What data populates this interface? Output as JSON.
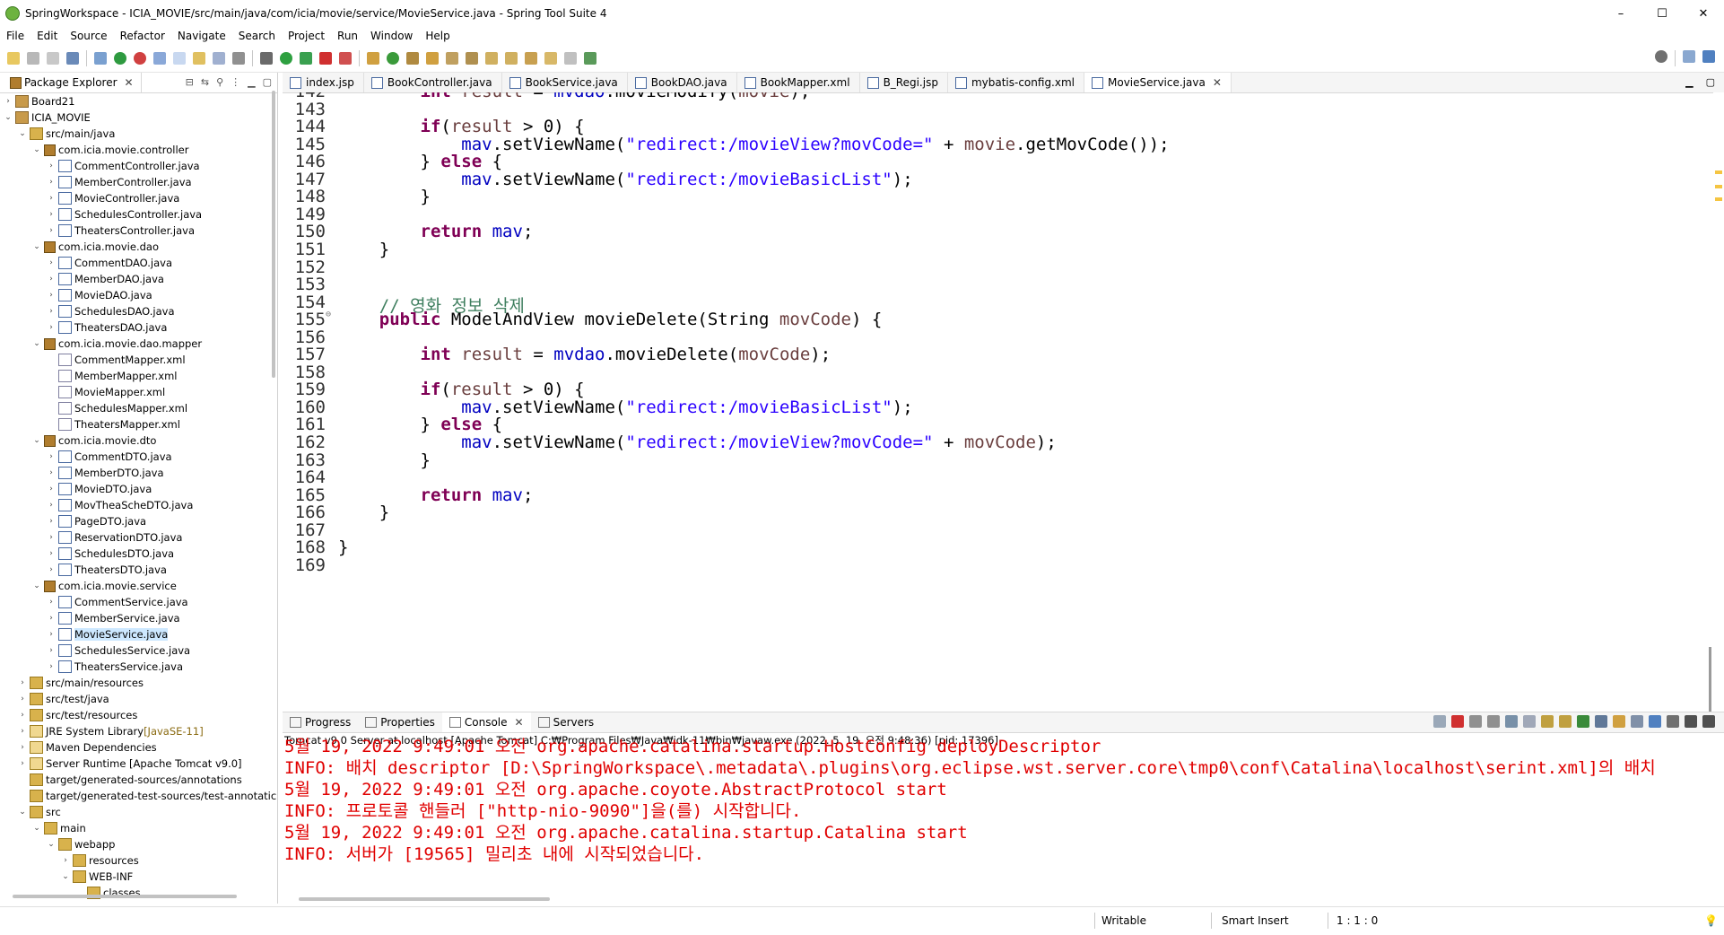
{
  "window": {
    "title": "SpringWorkspace - ICIA_MOVIE/src/main/java/com/icia/movie/service/MovieService.java - Spring Tool Suite 4",
    "minimize": "–",
    "maximize": "☐",
    "close": "✕"
  },
  "menu": [
    "File",
    "Edit",
    "Source",
    "Refactor",
    "Navigate",
    "Search",
    "Project",
    "Run",
    "Window",
    "Help"
  ],
  "package_explorer": {
    "tab_label": "Package Explorer",
    "tree": [
      {
        "label": "Board21",
        "level": 0,
        "twisty": "›",
        "icon": "proj"
      },
      {
        "label": "ICIA_MOVIE",
        "level": 0,
        "twisty": "⌄",
        "icon": "proj"
      },
      {
        "label": "src/main/java",
        "level": 1,
        "twisty": "⌄",
        "icon": "folder"
      },
      {
        "label": "com.icia.movie.controller",
        "level": 2,
        "twisty": "⌄",
        "icon": "pkg"
      },
      {
        "label": "CommentController.java",
        "level": 3,
        "twisty": "›",
        "icon": "java"
      },
      {
        "label": "MemberController.java",
        "level": 3,
        "twisty": "›",
        "icon": "java"
      },
      {
        "label": "MovieController.java",
        "level": 3,
        "twisty": "›",
        "icon": "java"
      },
      {
        "label": "SchedulesController.java",
        "level": 3,
        "twisty": "›",
        "icon": "java"
      },
      {
        "label": "TheatersController.java",
        "level": 3,
        "twisty": "›",
        "icon": "java"
      },
      {
        "label": "com.icia.movie.dao",
        "level": 2,
        "twisty": "⌄",
        "icon": "pkg"
      },
      {
        "label": "CommentDAO.java",
        "level": 3,
        "twisty": "›",
        "icon": "java"
      },
      {
        "label": "MemberDAO.java",
        "level": 3,
        "twisty": "›",
        "icon": "java"
      },
      {
        "label": "MovieDAO.java",
        "level": 3,
        "twisty": "›",
        "icon": "java"
      },
      {
        "label": "SchedulesDAO.java",
        "level": 3,
        "twisty": "›",
        "icon": "java"
      },
      {
        "label": "TheatersDAO.java",
        "level": 3,
        "twisty": "›",
        "icon": "java"
      },
      {
        "label": "com.icia.movie.dao.mapper",
        "level": 2,
        "twisty": "⌄",
        "icon": "pkg"
      },
      {
        "label": "CommentMapper.xml",
        "level": 3,
        "twisty": "",
        "icon": "xml"
      },
      {
        "label": "MemberMapper.xml",
        "level": 3,
        "twisty": "",
        "icon": "xml"
      },
      {
        "label": "MovieMapper.xml",
        "level": 3,
        "twisty": "",
        "icon": "xml"
      },
      {
        "label": "SchedulesMapper.xml",
        "level": 3,
        "twisty": "",
        "icon": "xml"
      },
      {
        "label": "TheatersMapper.xml",
        "level": 3,
        "twisty": "",
        "icon": "xml"
      },
      {
        "label": "com.icia.movie.dto",
        "level": 2,
        "twisty": "⌄",
        "icon": "pkg"
      },
      {
        "label": "CommentDTO.java",
        "level": 3,
        "twisty": "›",
        "icon": "java"
      },
      {
        "label": "MemberDTO.java",
        "level": 3,
        "twisty": "›",
        "icon": "java"
      },
      {
        "label": "MovieDTO.java",
        "level": 3,
        "twisty": "›",
        "icon": "java"
      },
      {
        "label": "MovTheaScheDTO.java",
        "level": 3,
        "twisty": "›",
        "icon": "java"
      },
      {
        "label": "PageDTO.java",
        "level": 3,
        "twisty": "›",
        "icon": "java"
      },
      {
        "label": "ReservationDTO.java",
        "level": 3,
        "twisty": "›",
        "icon": "java"
      },
      {
        "label": "SchedulesDTO.java",
        "level": 3,
        "twisty": "›",
        "icon": "java"
      },
      {
        "label": "TheatersDTO.java",
        "level": 3,
        "twisty": "›",
        "icon": "java"
      },
      {
        "label": "com.icia.movie.service",
        "level": 2,
        "twisty": "⌄",
        "icon": "pkg"
      },
      {
        "label": "CommentService.java",
        "level": 3,
        "twisty": "›",
        "icon": "java"
      },
      {
        "label": "MemberService.java",
        "level": 3,
        "twisty": "›",
        "icon": "java"
      },
      {
        "label": "MovieService.java",
        "level": 3,
        "twisty": "›",
        "icon": "java",
        "selected": true
      },
      {
        "label": "SchedulesService.java",
        "level": 3,
        "twisty": "›",
        "icon": "java"
      },
      {
        "label": "TheatersService.java",
        "level": 3,
        "twisty": "›",
        "icon": "java"
      },
      {
        "label": "src/main/resources",
        "level": 1,
        "twisty": "›",
        "icon": "folder"
      },
      {
        "label": "src/test/java",
        "level": 1,
        "twisty": "›",
        "icon": "folder"
      },
      {
        "label": "src/test/resources",
        "level": 1,
        "twisty": "›",
        "icon": "folder"
      },
      {
        "label": "JRE System Library",
        "suffix": " [JavaSE-11]",
        "level": 1,
        "twisty": "›",
        "icon": "lib"
      },
      {
        "label": "Maven Dependencies",
        "level": 1,
        "twisty": "›",
        "icon": "lib"
      },
      {
        "label": "Server Runtime [Apache Tomcat v9.0]",
        "level": 1,
        "twisty": "›",
        "icon": "lib"
      },
      {
        "label": "target/generated-sources/annotations",
        "level": 1,
        "twisty": "",
        "icon": "folder"
      },
      {
        "label": "target/generated-test-sources/test-annotatic",
        "level": 1,
        "twisty": "",
        "icon": "folder"
      },
      {
        "label": "src",
        "level": 1,
        "twisty": "⌄",
        "icon": "folder"
      },
      {
        "label": "main",
        "level": 2,
        "twisty": "⌄",
        "icon": "folder"
      },
      {
        "label": "webapp",
        "level": 3,
        "twisty": "⌄",
        "icon": "folder"
      },
      {
        "label": "resources",
        "level": 4,
        "twisty": "›",
        "icon": "folder"
      },
      {
        "label": "WEB-INF",
        "level": 4,
        "twisty": "⌄",
        "icon": "folder"
      },
      {
        "label": "classes",
        "level": 5,
        "twisty": "",
        "icon": "folder"
      }
    ]
  },
  "editor": {
    "tabs": [
      {
        "label": "index.jsp",
        "active": false
      },
      {
        "label": "BookController.java",
        "active": false
      },
      {
        "label": "BookService.java",
        "active": false
      },
      {
        "label": "BookDAO.java",
        "active": false
      },
      {
        "label": "BookMapper.xml",
        "active": false
      },
      {
        "label": "B_Regi.jsp",
        "active": false
      },
      {
        "label": "mybatis-config.xml",
        "active": false
      },
      {
        "label": "MovieService.java",
        "active": true
      }
    ],
    "lines": [
      {
        "n": "142",
        "fold": "",
        "tokens": [
          [
            "",
            "        "
          ],
          [
            "kw",
            "int"
          ],
          [
            "",
            " "
          ],
          [
            "lv",
            "result"
          ],
          [
            "",
            " = "
          ],
          [
            "fld",
            "mvdao"
          ],
          [
            "",
            ".movieModify("
          ],
          [
            "lv",
            "movie"
          ],
          [
            "",
            ");"
          ]
        ]
      },
      {
        "n": "143",
        "fold": "",
        "tokens": []
      },
      {
        "n": "144",
        "fold": "",
        "tokens": [
          [
            "",
            "        "
          ],
          [
            "kw",
            "if"
          ],
          [
            "",
            "("
          ],
          [
            "lv",
            "result"
          ],
          [
            "",
            " > 0) {"
          ]
        ]
      },
      {
        "n": "145",
        "fold": "",
        "tokens": [
          [
            "",
            "            "
          ],
          [
            "fld",
            "mav"
          ],
          [
            "",
            ".setViewName("
          ],
          [
            "str",
            "\"redirect:/movieView?movCode=\""
          ],
          [
            "",
            " + "
          ],
          [
            "lv",
            "movie"
          ],
          [
            "",
            ".getMovCode());"
          ]
        ]
      },
      {
        "n": "146",
        "fold": "",
        "tokens": [
          [
            "",
            "        } "
          ],
          [
            "kw",
            "else"
          ],
          [
            "",
            " {"
          ]
        ]
      },
      {
        "n": "147",
        "fold": "",
        "tokens": [
          [
            "",
            "            "
          ],
          [
            "fld",
            "mav"
          ],
          [
            "",
            ".setViewName("
          ],
          [
            "str",
            "\"redirect:/movieBasicList\""
          ],
          [
            "",
            ");"
          ]
        ]
      },
      {
        "n": "148",
        "fold": "",
        "tokens": [
          [
            "",
            "        }"
          ]
        ]
      },
      {
        "n": "149",
        "fold": "",
        "tokens": []
      },
      {
        "n": "150",
        "fold": "",
        "tokens": [
          [
            "",
            "        "
          ],
          [
            "kw",
            "return"
          ],
          [
            "",
            " "
          ],
          [
            "fld",
            "mav"
          ],
          [
            "",
            ";"
          ]
        ]
      },
      {
        "n": "151",
        "fold": "",
        "tokens": [
          [
            "",
            "    }"
          ]
        ]
      },
      {
        "n": "152",
        "fold": "",
        "tokens": []
      },
      {
        "n": "153",
        "fold": "",
        "tokens": []
      },
      {
        "n": "154",
        "fold": "",
        "tokens": [
          [
            "",
            "    "
          ],
          [
            "cm",
            "// 영화 정보 삭제"
          ]
        ]
      },
      {
        "n": "155",
        "fold": "⊖",
        "tokens": [
          [
            "",
            "    "
          ],
          [
            "kw",
            "public"
          ],
          [
            "",
            " ModelAndView movieDelete(String "
          ],
          [
            "lv",
            "movCode"
          ],
          [
            "",
            ") {"
          ]
        ]
      },
      {
        "n": "156",
        "fold": "",
        "tokens": []
      },
      {
        "n": "157",
        "fold": "",
        "tokens": [
          [
            "",
            "        "
          ],
          [
            "kw",
            "int"
          ],
          [
            "",
            " "
          ],
          [
            "lv",
            "result"
          ],
          [
            "",
            " = "
          ],
          [
            "fld",
            "mvdao"
          ],
          [
            "",
            ".movieDelete("
          ],
          [
            "lv",
            "movCode"
          ],
          [
            "",
            ");"
          ]
        ]
      },
      {
        "n": "158",
        "fold": "",
        "tokens": []
      },
      {
        "n": "159",
        "fold": "",
        "tokens": [
          [
            "",
            "        "
          ],
          [
            "kw",
            "if"
          ],
          [
            "",
            "("
          ],
          [
            "lv",
            "result"
          ],
          [
            "",
            " > 0) {"
          ]
        ]
      },
      {
        "n": "160",
        "fold": "",
        "tokens": [
          [
            "",
            "            "
          ],
          [
            "fld",
            "mav"
          ],
          [
            "",
            ".setViewName("
          ],
          [
            "str",
            "\"redirect:/movieBasicList\""
          ],
          [
            "",
            ");"
          ]
        ]
      },
      {
        "n": "161",
        "fold": "",
        "tokens": [
          [
            "",
            "        } "
          ],
          [
            "kw",
            "else"
          ],
          [
            "",
            " {"
          ]
        ]
      },
      {
        "n": "162",
        "fold": "",
        "tokens": [
          [
            "",
            "            "
          ],
          [
            "fld",
            "mav"
          ],
          [
            "",
            ".setViewName("
          ],
          [
            "str",
            "\"redirect:/movieView?movCode=\""
          ],
          [
            "",
            " + "
          ],
          [
            "lv",
            "movCode"
          ],
          [
            "",
            ");"
          ]
        ]
      },
      {
        "n": "163",
        "fold": "",
        "tokens": [
          [
            "",
            "        }"
          ]
        ]
      },
      {
        "n": "164",
        "fold": "",
        "tokens": []
      },
      {
        "n": "165",
        "fold": "",
        "tokens": [
          [
            "",
            "        "
          ],
          [
            "kw",
            "return"
          ],
          [
            "",
            " "
          ],
          [
            "fld",
            "mav"
          ],
          [
            "",
            ";"
          ]
        ]
      },
      {
        "n": "166",
        "fold": "",
        "tokens": [
          [
            "",
            "    }"
          ]
        ]
      },
      {
        "n": "167",
        "fold": "",
        "tokens": []
      },
      {
        "n": "168",
        "fold": "",
        "tokens": [
          [
            "",
            "}"
          ]
        ]
      },
      {
        "n": "169",
        "fold": "",
        "tokens": []
      }
    ]
  },
  "console_view": {
    "tabs": [
      {
        "label": "Progress",
        "active": false
      },
      {
        "label": "Properties",
        "active": false
      },
      {
        "label": "Console",
        "active": true
      },
      {
        "label": "Servers",
        "active": false
      }
    ],
    "description": "Tomcat v9.0 Server at localhost [Apache Tomcat] C:₩Program Files₩Java₩jdk-11₩bin₩javaw.exe  (2022. 5. 19. 오전 9:48:36) [pid: 17396]",
    "output": [
      "5월 19, 2022 9:49:01 오전 org.apache.catalina.startup.HostConfig deployDescriptor",
      "INFO: 배치 descriptor [D:\\SpringWorkspace\\.metadata\\.plugins\\org.eclipse.wst.server.core\\tmp0\\conf\\Catalina\\localhost\\serint.xml]의 배치",
      "5월 19, 2022 9:49:01 오전 org.apache.coyote.AbstractProtocol start",
      "INFO: 프로토콜 핸들러 [\"http-nio-9090\"]을(를) 시작합니다.",
      "5월 19, 2022 9:49:01 오전 org.apache.catalina.startup.Catalina start",
      "INFO: 서버가 [19565] 밀리초 내에 시작되었습니다."
    ]
  },
  "status": {
    "writable": "Writable",
    "insert_mode": "Smart Insert",
    "position": "1 : 1 : 0"
  },
  "colors": {
    "keyword": "#7f0055",
    "string": "#2a00ff",
    "field": "#0000c0",
    "comment": "#3f7f5f",
    "console_text": "#e00000",
    "selection": "#cde8ff"
  }
}
